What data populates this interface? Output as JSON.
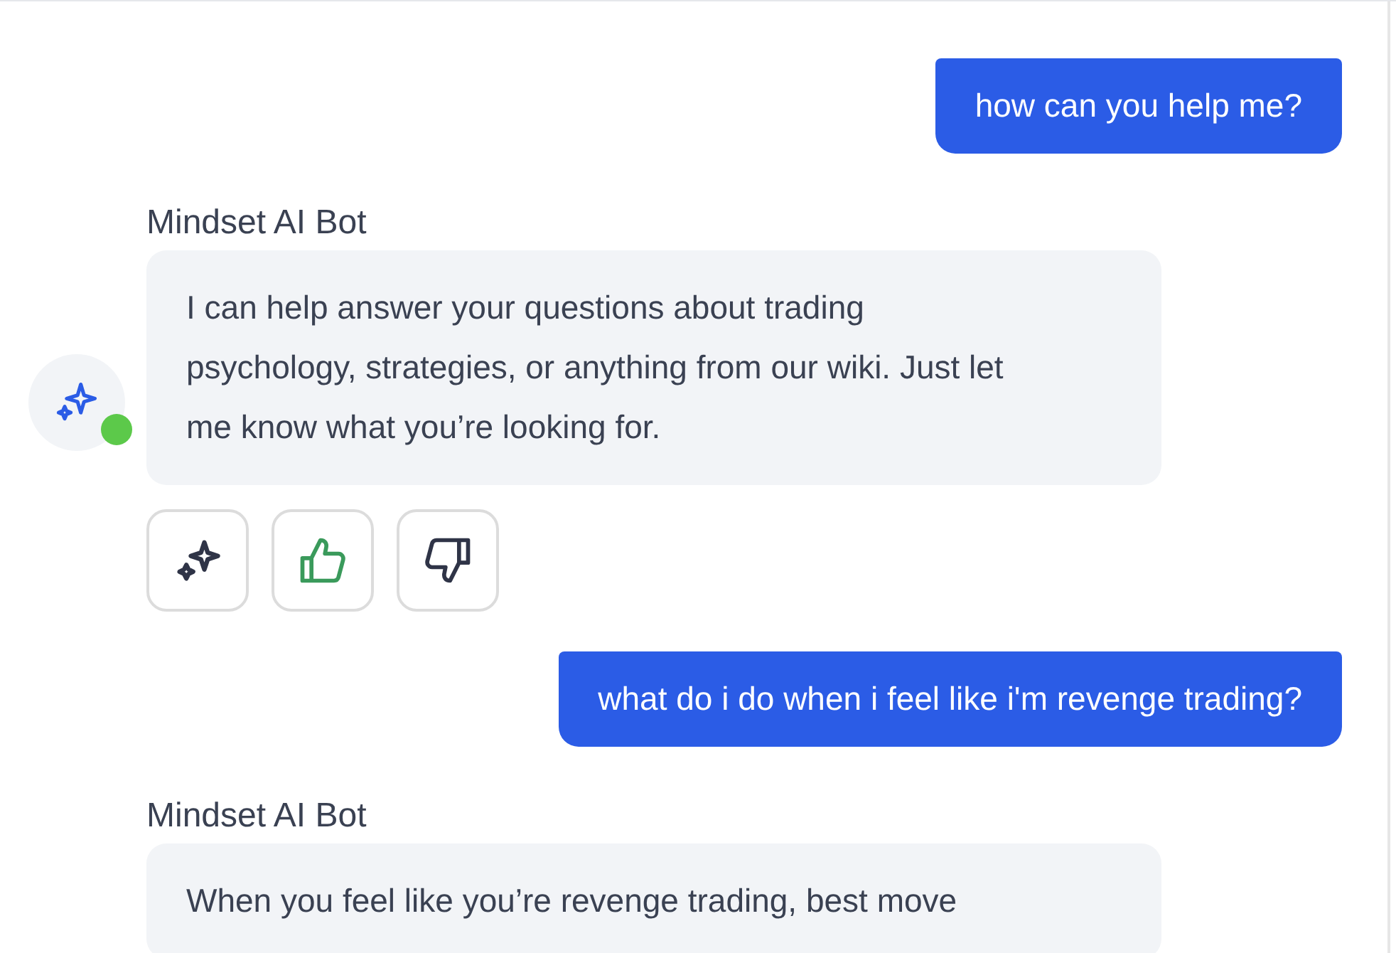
{
  "messages": [
    {
      "kind": "user",
      "text": "how can you help me?"
    },
    {
      "kind": "bot",
      "sender": "Mindset AI Bot",
      "text": "I can help answer your questions about trading psychology, strategies, or anything from our wiki. Just let me know what you’re looking for.",
      "avatar": true,
      "online": true,
      "feedback": {
        "liked": true,
        "disliked": false
      }
    },
    {
      "kind": "user",
      "text": "what do i do when i feel like i'm revenge trading?"
    },
    {
      "kind": "bot",
      "sender": "Mindset AI Bot",
      "text": "When you feel like you’re revenge trading, best move"
    }
  ]
}
